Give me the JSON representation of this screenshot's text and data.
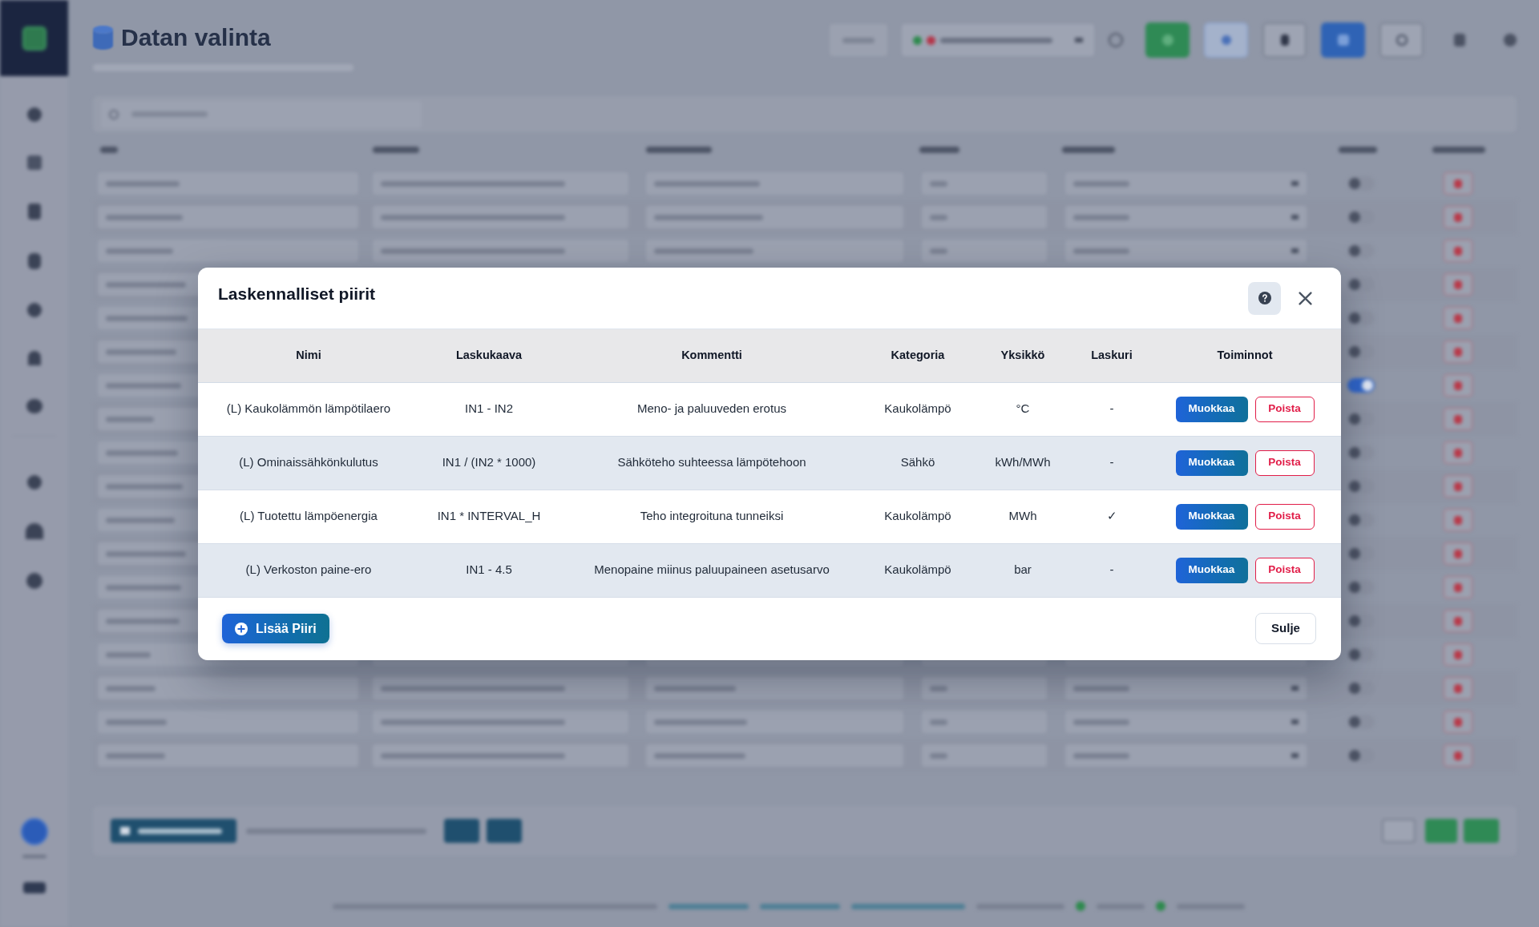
{
  "page": {
    "title": "Datan valinta"
  },
  "dialog": {
    "title": "Laskennalliset piirit",
    "columns": [
      "Nimi",
      "Laskukaava",
      "Kommentti",
      "Kategoria",
      "Yksikkö",
      "Laskuri",
      "Toiminnot"
    ],
    "rows": [
      {
        "name": "(L) Kaukolämmön lämpötilaero",
        "formula": "IN1 - IN2",
        "comment": "Meno- ja paluuveden erotus",
        "category": "Kaukolämpö",
        "unit": "°C",
        "counter": "-",
        "edit_button": "Muokkaa",
        "delete_button": "Poista"
      },
      {
        "name": "(L) Ominaissähkönkulutus",
        "formula": "IN1 / (IN2 * 1000)",
        "comment": "Sähköteho suhteessa lämpötehoon",
        "category": "Sähkö",
        "unit": "kWh/MWh",
        "counter": "-",
        "edit_button": "Muokkaa",
        "delete_button": "Poista"
      },
      {
        "name": "(L) Tuotettu lämpöenergia",
        "formula": "IN1 * INTERVAL_H",
        "comment": "Teho integroituna tunneiksi",
        "category": "Kaukolämpö",
        "unit": "MWh",
        "counter": "✓",
        "edit_button": "Muokkaa",
        "delete_button": "Poista"
      },
      {
        "name": "(L) Verkoston paine-ero",
        "formula": "IN1 - 4.5",
        "comment": "Menopaine miinus paluupaineen asetusarvo",
        "category": "Kaukolämpö",
        "unit": "bar",
        "counter": "-",
        "edit_button": "Muokkaa",
        "delete_button": "Poista"
      }
    ],
    "add_button": "Lisää Piiri",
    "close_button": "Sulje"
  }
}
